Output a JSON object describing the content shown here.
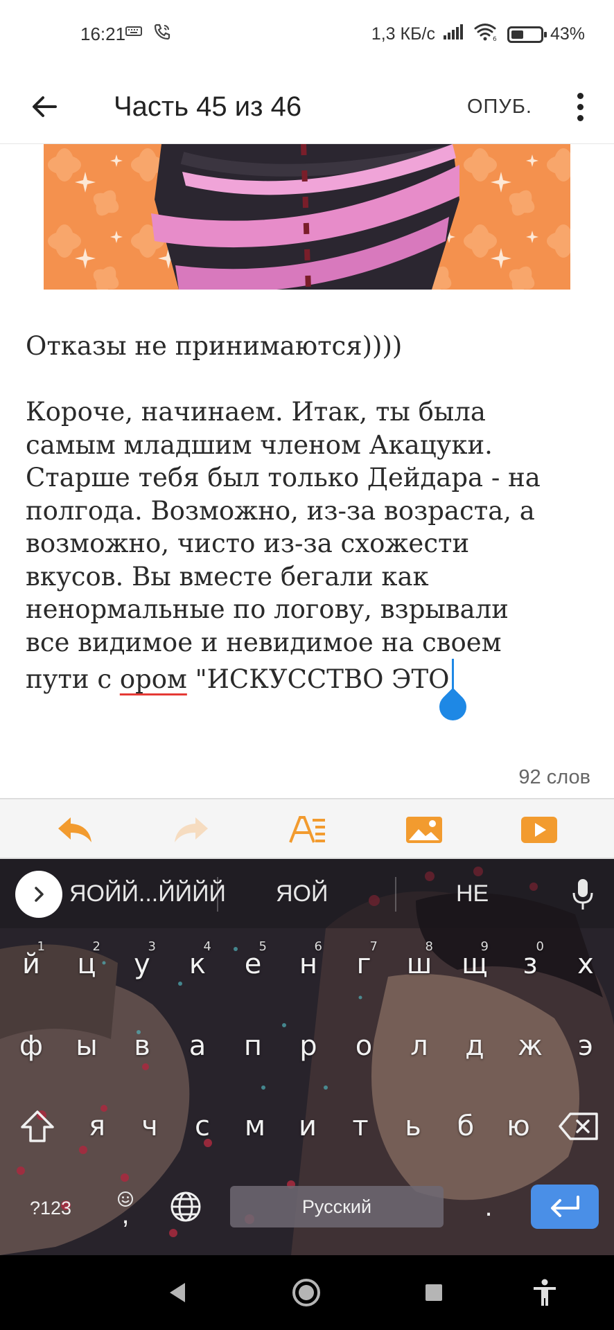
{
  "status_bar": {
    "time": "16:21",
    "net_speed": "1,3 КБ/с",
    "battery_percent": "43%",
    "battery_level": 0.43,
    "icons": [
      "keyboard-icon",
      "call-icon",
      "signal-icon",
      "wifi-icon",
      "battery-icon"
    ]
  },
  "app_bar": {
    "back_icon": "arrow-back-icon",
    "title": "Часть 45 из 46",
    "publish_label": "ОПУБ.",
    "more_icon": "more-vert-icon"
  },
  "editor": {
    "line_1": "Отказы не принимаются))))",
    "paragraph_lines": [
      "Короче, начинаем. Итак, ты была",
      "самым младшим членом Акацуки.",
      "Старше тебя был только Дейдара - на",
      "полгода. Возможно, из-за возраста, а",
      "возможно, чисто из-за схожести",
      "вкусов. Вы вместе бегали как",
      "ненормальные по логову, взрывали",
      "все видимое и невидимое на своем"
    ],
    "last_line_before": "пути с ",
    "misspelled_word": "ором",
    "last_line_after": " \"ИСКУССТВО ЭТО",
    "word_count": "92 слов",
    "colors": {
      "caret": "#1e88e5",
      "spell_underline": "#e53935"
    }
  },
  "toolbar": {
    "tools": [
      "undo-icon",
      "redo-icon",
      "text-format-icon",
      "insert-image-icon",
      "insert-video-icon"
    ],
    "accent_color": "#f29b2f"
  },
  "keyboard": {
    "suggestions": [
      "ЯОЙЙ...ЙЙЙЙ",
      "ЯОЙ",
      "НЕ"
    ],
    "row_1": [
      {
        "k": "й",
        "n": "1"
      },
      {
        "k": "ц",
        "n": "2"
      },
      {
        "k": "у",
        "n": "3"
      },
      {
        "k": "к",
        "n": "4"
      },
      {
        "k": "е",
        "n": "5"
      },
      {
        "k": "н",
        "n": "6"
      },
      {
        "k": "г",
        "n": "7"
      },
      {
        "k": "ш",
        "n": "8"
      },
      {
        "k": "щ",
        "n": "9"
      },
      {
        "k": "з",
        "n": "0"
      },
      {
        "k": "х",
        "n": ""
      }
    ],
    "row_2": [
      "ф",
      "ы",
      "в",
      "а",
      "п",
      "р",
      "о",
      "л",
      "д",
      "ж",
      "э"
    ],
    "row_3": [
      "я",
      "ч",
      "с",
      "м",
      "и",
      "т",
      "ь",
      "б",
      "ю"
    ],
    "symbols_label": "?123",
    "emoji_comma": ",",
    "space_label": "Русский",
    "period": ".",
    "enter_color": "#4a8fe7"
  },
  "nav_bar": {
    "buttons": [
      "back-triangle-icon",
      "home-circle-icon",
      "recents-square-icon",
      "accessibility-icon"
    ]
  }
}
